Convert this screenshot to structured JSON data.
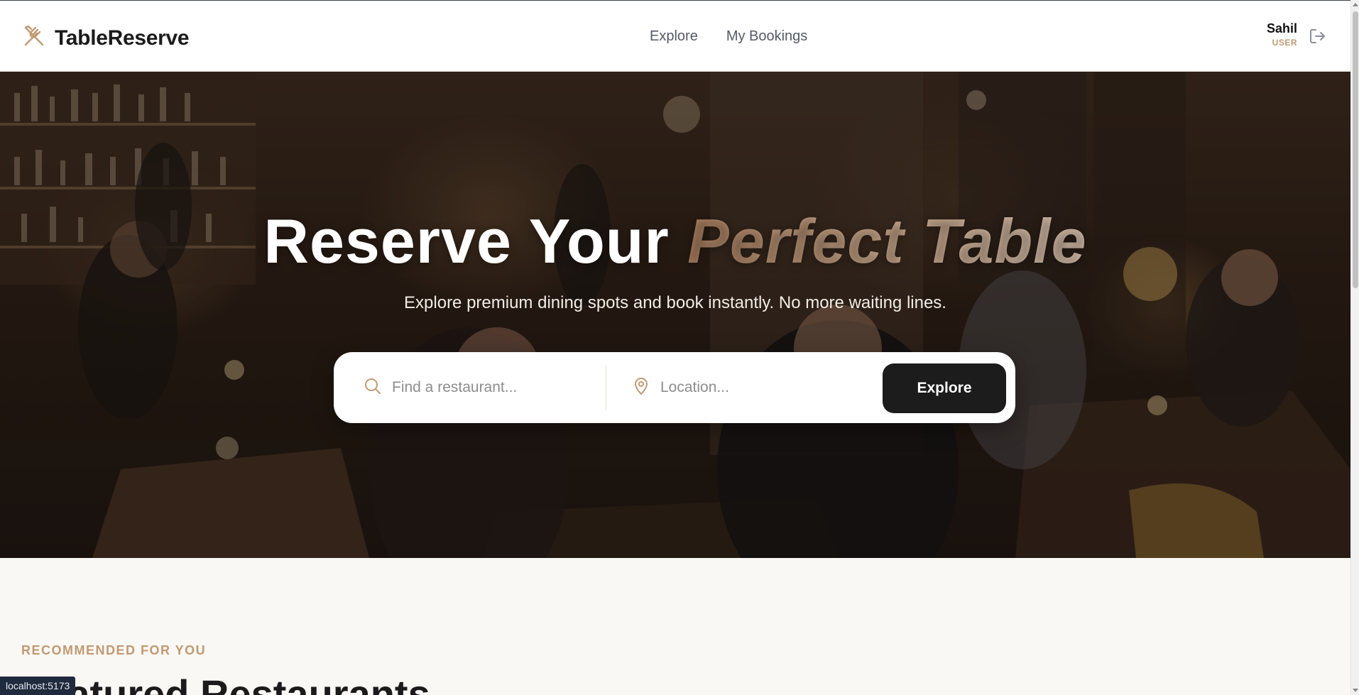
{
  "app": {
    "brand": "TableReserve",
    "accent_color": "#c19a73"
  },
  "nav": {
    "items": [
      {
        "label": "Explore"
      },
      {
        "label": "My Bookings"
      }
    ]
  },
  "user": {
    "name": "Sahil",
    "role": "USER",
    "logout_icon": "logout-icon"
  },
  "hero": {
    "title_plain": "Reserve Your",
    "title_accent": "Perfect Table",
    "subtitle": "Explore premium dining spots and book instantly. No more waiting lines."
  },
  "search": {
    "restaurant_placeholder": "Find a restaurant...",
    "location_placeholder": "Location...",
    "button_label": "Explore"
  },
  "section": {
    "kicker": "RECOMMENDED FOR YOU",
    "title": "Featured Restaurants"
  },
  "status_bar": {
    "url": "localhost:5173"
  }
}
